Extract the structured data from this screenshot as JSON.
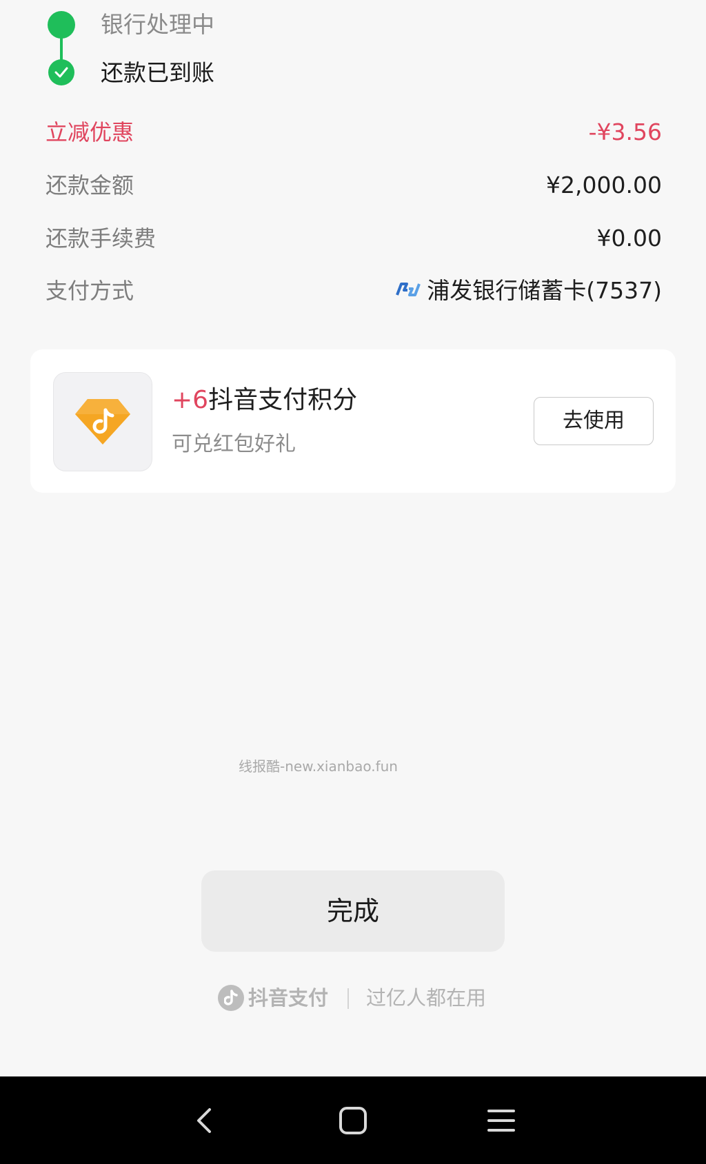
{
  "status": {
    "steps": [
      {
        "label": "银行处理中"
      },
      {
        "label": "还款已到账"
      }
    ]
  },
  "details": {
    "discount": {
      "label": "立减优惠",
      "value": "-¥3.56"
    },
    "amount": {
      "label": "还款金额",
      "value": "¥2,000.00"
    },
    "fee": {
      "label": "还款手续费",
      "value": "¥0.00"
    },
    "payment_method": {
      "label": "支付方式",
      "value": "浦发银行储蓄卡(7537)"
    }
  },
  "points_card": {
    "points": "+6",
    "title": "抖音支付积分",
    "subtitle": "可兑红包好礼",
    "button_label": "去使用"
  },
  "watermark": "线报酷-new.xianbao.fun",
  "done_button": "完成",
  "footer": {
    "brand": "抖音支付",
    "slogan": "过亿人都在用"
  },
  "icons": {
    "step_done": "check-circle-icon",
    "bank": "spdb-bank-logo",
    "app": "douyin-pay-logo",
    "nav": [
      "back-icon",
      "home-icon",
      "menu-icon"
    ]
  },
  "colors": {
    "success": "#1fbe5a",
    "discount": "#e0455e",
    "points_icon": "#f5a623"
  }
}
